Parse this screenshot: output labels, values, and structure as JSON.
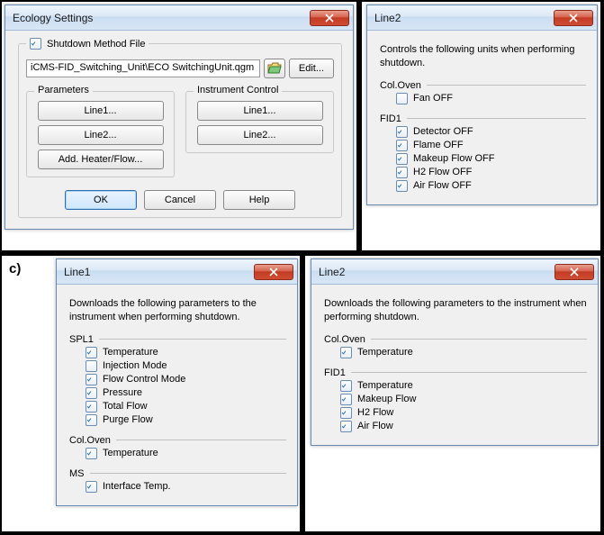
{
  "a": {
    "title": "Ecology Settings",
    "shutdown_chk_label": "Shutdown Method File",
    "file_path": "iCMS-FID_Switching_Unit\\ECO SwitchingUnit.qgm",
    "edit_label": "Edit...",
    "group_params": "Parameters",
    "group_instr": "Instrument Control",
    "btn_line1": "Line1...",
    "btn_line2": "Line2...",
    "btn_add": "Add. Heater/Flow...",
    "ok": "OK",
    "cancel": "Cancel",
    "help": "Help"
  },
  "b": {
    "title": "Line2",
    "desc": "Controls the following units when performing shutdown.",
    "sec1": "Col.Oven",
    "s1_i0": "Fan OFF",
    "sec2": "FID1",
    "s2_i0": "Detector OFF",
    "s2_i1": "Flame OFF",
    "s2_i2": "Makeup Flow OFF",
    "s2_i3": "H2 Flow OFF",
    "s2_i4": "Air Flow OFF"
  },
  "c": {
    "title": "Line1",
    "desc": "Downloads the following parameters to the instrument when performing shutdown.",
    "sec1": "SPL1",
    "s1_i0": "Temperature",
    "s1_i1": "Injection Mode",
    "s1_i2": "Flow Control Mode",
    "s1_i3": "Pressure",
    "s1_i4": "Total Flow",
    "s1_i5": "Purge Flow",
    "sec2": "Col.Oven",
    "s2_i0": "Temperature",
    "sec3": "MS",
    "s3_i0": "Interface Temp."
  },
  "d": {
    "title": "Line2",
    "desc": "Downloads the following parameters to the instrument when performing shutdown.",
    "sec1": "Col.Oven",
    "s1_i0": "Temperature",
    "sec2": "FID1",
    "s2_i0": "Temperature",
    "s2_i1": "Makeup Flow",
    "s2_i2": "H2 Flow",
    "s2_i3": "Air Flow"
  }
}
